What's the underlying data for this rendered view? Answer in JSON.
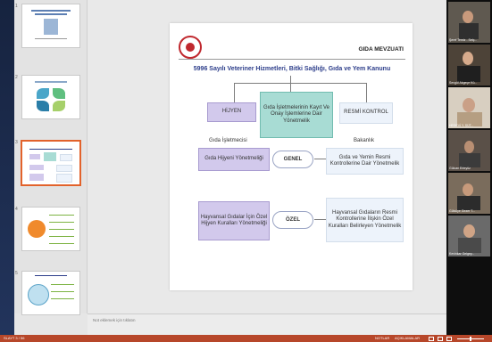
{
  "notes": {
    "placeholder": "Not eklemek için tıklatın"
  },
  "thumbnails": [
    {
      "number": "1"
    },
    {
      "number": "2"
    },
    {
      "number": "3"
    },
    {
      "number": "4"
    },
    {
      "number": "5"
    }
  ],
  "slide": {
    "header": "GIDA MEVZUATI",
    "law": "5996 Sayılı Veteriner Hizmetleri, Bitki Sağlığı, Gıda ve Yem Kanunu",
    "hijyen": "HİJYEN",
    "center": "Gıda İşletmelerinin Kayıt Ve Onay İşlemlerine Dair Yönetmelik",
    "resmi": "RESMİ KONTROL",
    "left_label": "Gıda İşletmecisi",
    "right_label": "Bakanlık",
    "gida_hijyeni": "Gıda Hijyeni Yönetmeliği",
    "genel": "GENEL",
    "resmi_kontroller": "Gıda ve Yemin Resmi Kontrollerine Dair Yönetmelik",
    "hayvansal_left": "Hayvansal Gıdalar İçin Özel Hijyen Kuralları Yönetmeliği",
    "ozel": "ÖZEL",
    "hayvansal_right": "Hayvansal Gıdaların Resmi Kontrollerine İlişkin Özel Kuralları Belirleyen Yönetmelik"
  },
  "participants": [
    {
      "name": "Şeref Temiz - Selç..."
    },
    {
      "name": "Sevgül Akgeçe Kü..."
    },
    {
      "name": "HEDEVİ Y. SÜT..."
    },
    {
      "name": "Gülcan Erteyüz"
    },
    {
      "name": "Gülsüye Gezer T..."
    },
    {
      "name": "Kevinkar Gelgey..."
    }
  ],
  "statusbar": {
    "left": "SLAYT 3 / 56",
    "notes": "NOTLAR",
    "comments": "AÇIKLAMALAR"
  },
  "colors": {
    "purple_box": "#d2c9ec",
    "teal_box": "#a8dcd4",
    "light_box": "#edf3fb",
    "title_blue": "#2c3d8a",
    "status_bar": "#b7472a",
    "selected_thumb": "#e2622b"
  }
}
